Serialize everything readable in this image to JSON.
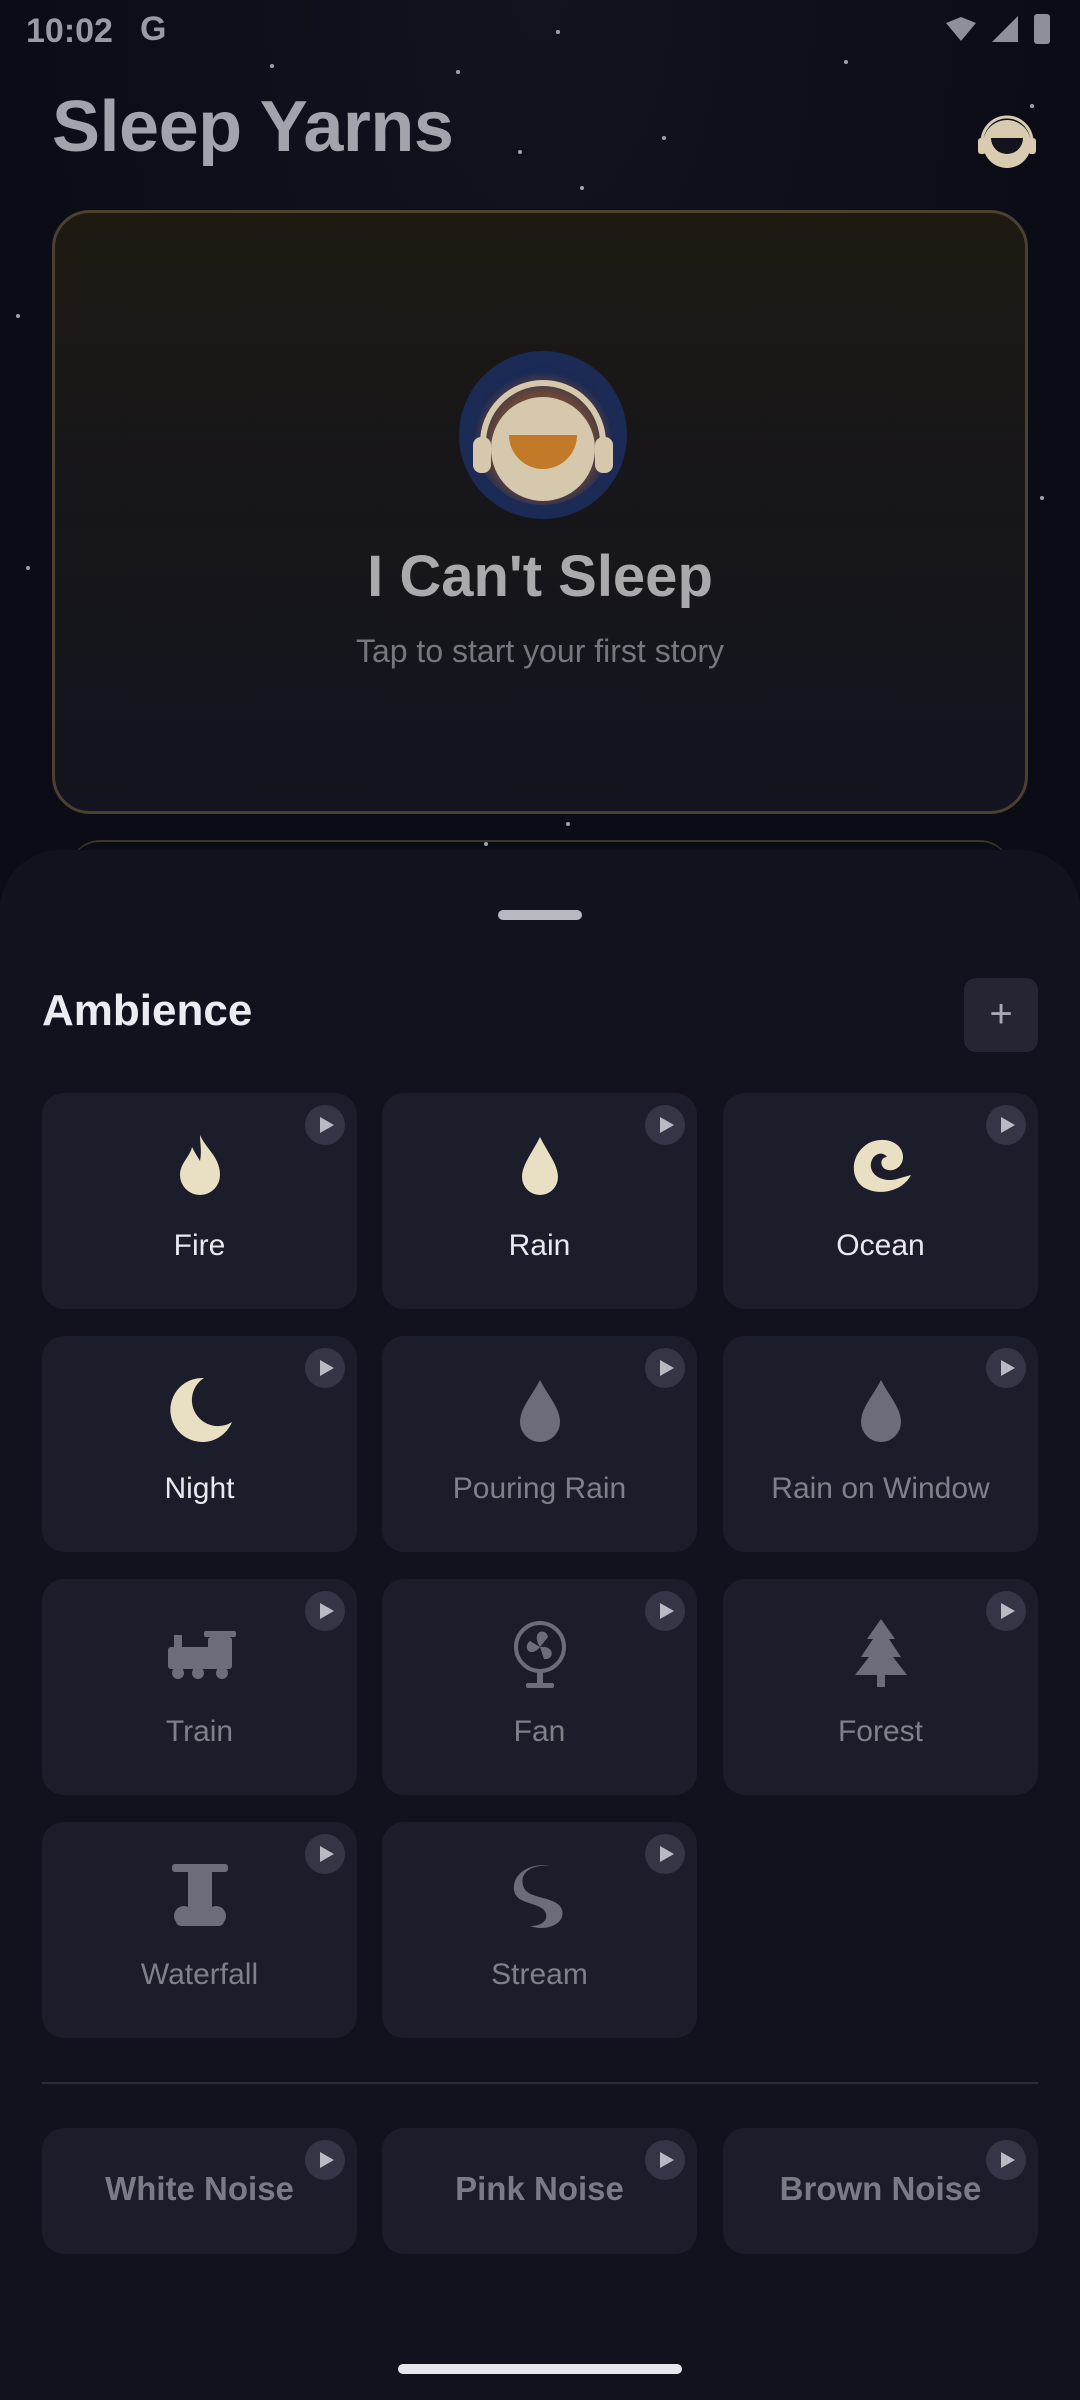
{
  "status_bar": {
    "time": "10:02",
    "g_badge": "G"
  },
  "header": {
    "title": "Sleep Yarns",
    "avatar_icon": "sleeper-headphones-icon"
  },
  "hero": {
    "title": "I Can't Sleep",
    "subtitle": "Tap to start your first story",
    "icon": "sleeper-headphones-icon"
  },
  "sheet": {
    "title": "Ambience",
    "add_label": "+",
    "sounds": [
      {
        "label": "Fire",
        "icon": "fire-icon",
        "active": true
      },
      {
        "label": "Rain",
        "icon": "raindrop-icon",
        "active": true
      },
      {
        "label": "Ocean",
        "icon": "wave-icon",
        "active": true
      },
      {
        "label": "Night",
        "icon": "moon-icon",
        "active": true
      },
      {
        "label": "Pouring Rain",
        "icon": "raindrop-icon",
        "active": false
      },
      {
        "label": "Rain on Window",
        "icon": "raindrop-icon",
        "active": false
      },
      {
        "label": "Train",
        "icon": "train-icon",
        "active": false
      },
      {
        "label": "Fan",
        "icon": "fan-icon",
        "active": false
      },
      {
        "label": "Forest",
        "icon": "pine-tree-icon",
        "active": false
      },
      {
        "label": "Waterfall",
        "icon": "waterfall-icon",
        "active": false
      },
      {
        "label": "Stream",
        "icon": "stream-icon",
        "active": false
      }
    ],
    "noises": [
      {
        "label": "White Noise"
      },
      {
        "label": "Pink Noise"
      },
      {
        "label": "Brown Noise"
      }
    ]
  },
  "colors": {
    "accent_gold": "#e9dfc2",
    "inactive_icon": "#6c6d7a",
    "background": "#0d0e18"
  }
}
